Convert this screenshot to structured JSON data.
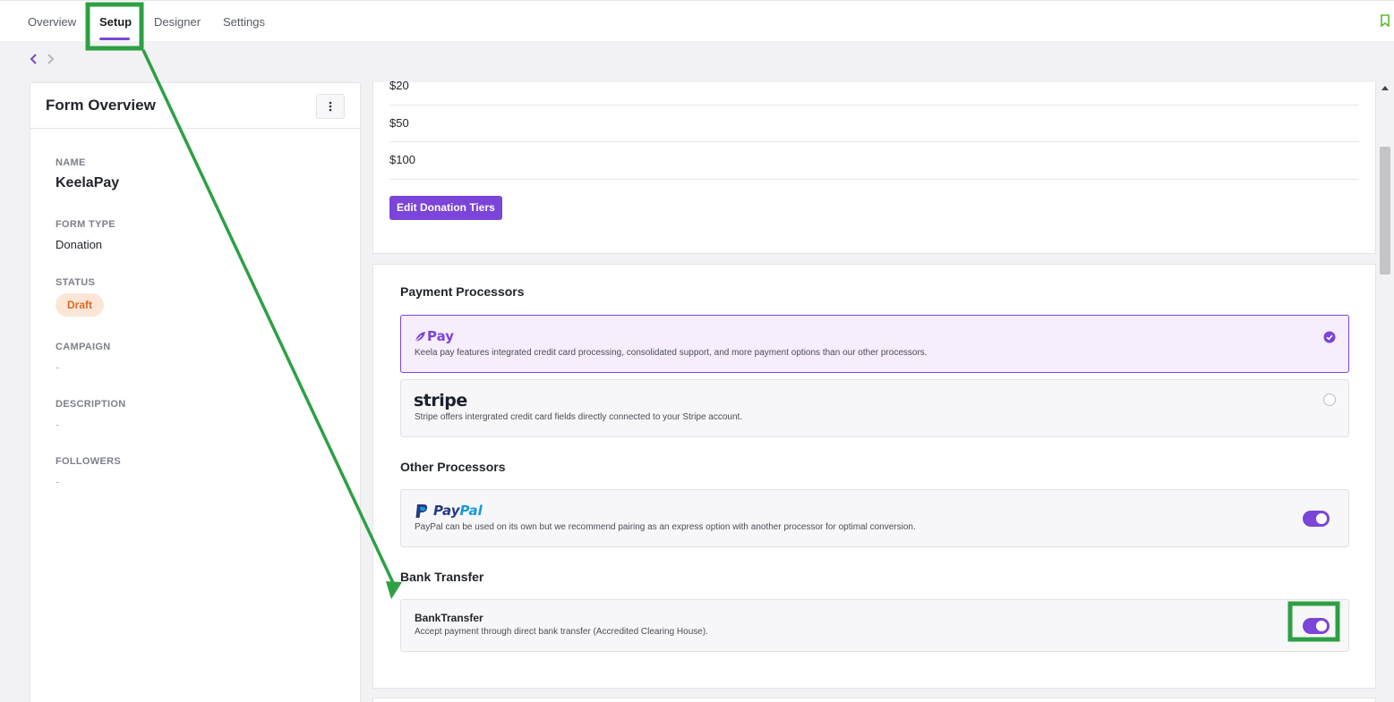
{
  "tabs": [
    {
      "label": "Overview"
    },
    {
      "label": "Setup",
      "active": true
    },
    {
      "label": "Designer"
    },
    {
      "label": "Settings"
    }
  ],
  "accent_color": "#7a45d8",
  "left_panel": {
    "title": "Form Overview",
    "fields": {
      "name": {
        "label": "NAME",
        "value": "KeelaPay"
      },
      "form_type": {
        "label": "FORM TYPE",
        "value": "Donation"
      },
      "status": {
        "label": "STATUS",
        "value": "Draft"
      },
      "campaign": {
        "label": "CAMPAIGN",
        "value": "-"
      },
      "description": {
        "label": "DESCRIPTION",
        "value": "-"
      },
      "followers": {
        "label": "FOLLOWERS",
        "value": "-"
      }
    }
  },
  "donation_tiers": {
    "tiers": [
      "$20",
      "$50",
      "$100"
    ],
    "edit_button": "Edit Donation Tiers"
  },
  "payment_processors": {
    "title": "Payment Processors",
    "keelapay": {
      "logo_text": "Pay",
      "description": "Keela pay features integrated credit card processing, consolidated support, and more payment options than our other processors.",
      "selected": true
    },
    "stripe": {
      "logo_text": "stripe",
      "description": "Stripe offers intergrated credit card fields directly connected to your Stripe account.",
      "selected": false
    }
  },
  "other_processors": {
    "title": "Other Processors",
    "paypal": {
      "logo_text_1": "Pay",
      "logo_text_2": "Pal",
      "description": "PayPal can be used on its own but we recommend pairing as an express option with another processor for optimal conversion.",
      "enabled": true
    }
  },
  "bank_transfer": {
    "title": "Bank Transfer",
    "name": "BankTransfer",
    "description": "Accept payment through direct bank transfer (Accredited Clearing House).",
    "enabled": true
  },
  "annotation_color": "#2ea043"
}
